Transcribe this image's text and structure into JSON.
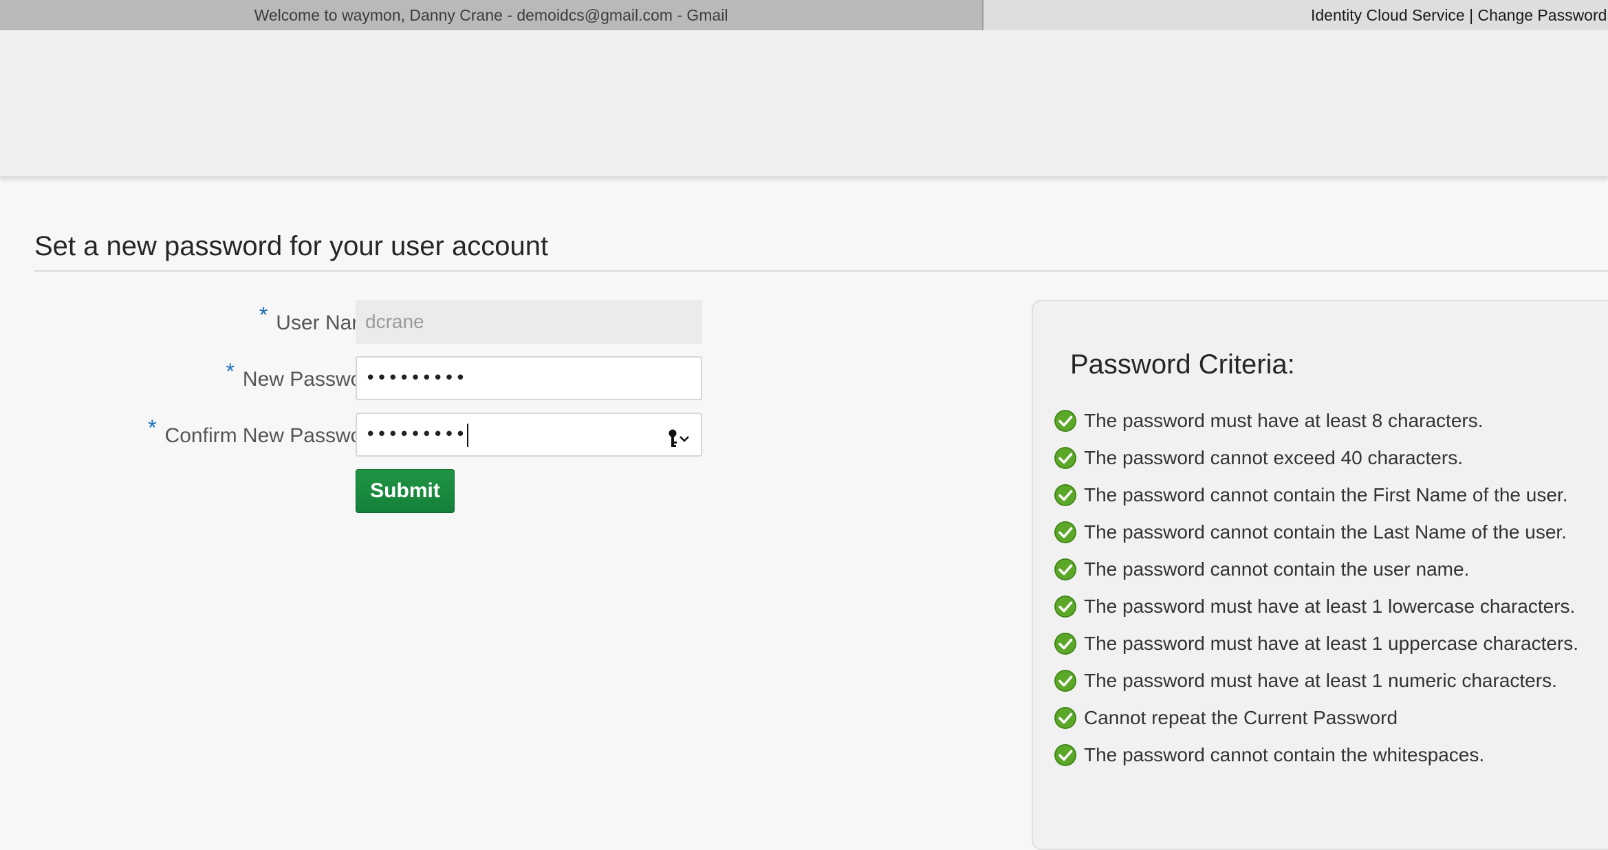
{
  "browser": {
    "tabs": [
      {
        "title": "Welcome to waymon, Danny Crane - demoidcs@gmail.com - Gmail",
        "active": false
      },
      {
        "title": "Identity Cloud Service | Change Password",
        "active": true
      }
    ]
  },
  "page": {
    "title": "Set a new password for your user account"
  },
  "form": {
    "required_marker": "*",
    "username": {
      "label": "User Name",
      "value": "dcrane"
    },
    "new_password": {
      "label": "New Password",
      "masked_value": "•••••••••"
    },
    "confirm_password": {
      "label": "Confirm New Password",
      "masked_value": "•••••••••"
    },
    "submit_label": "Submit",
    "submit_color": "#1a8a3e"
  },
  "criteria": {
    "title": "Password Criteria:",
    "icon": "check-circle-icon",
    "icon_color": "#5ba829",
    "items": [
      {
        "text": "The password must have at least 8 characters.",
        "met": true
      },
      {
        "text": "The password cannot exceed 40 characters.",
        "met": true
      },
      {
        "text": "The password cannot contain the First Name of the user.",
        "met": true
      },
      {
        "text": "The password cannot contain the Last Name of the user.",
        "met": true
      },
      {
        "text": "The password cannot contain the user name.",
        "met": true
      },
      {
        "text": "The password must have at least 1 lowercase characters.",
        "met": true
      },
      {
        "text": "The password must have at least 1 uppercase characters.",
        "met": true
      },
      {
        "text": "The password must have at least 1 numeric characters.",
        "met": true
      },
      {
        "text": "Cannot repeat the Current Password",
        "met": true
      },
      {
        "text": "The password cannot contain the whitespaces.",
        "met": true
      }
    ]
  }
}
